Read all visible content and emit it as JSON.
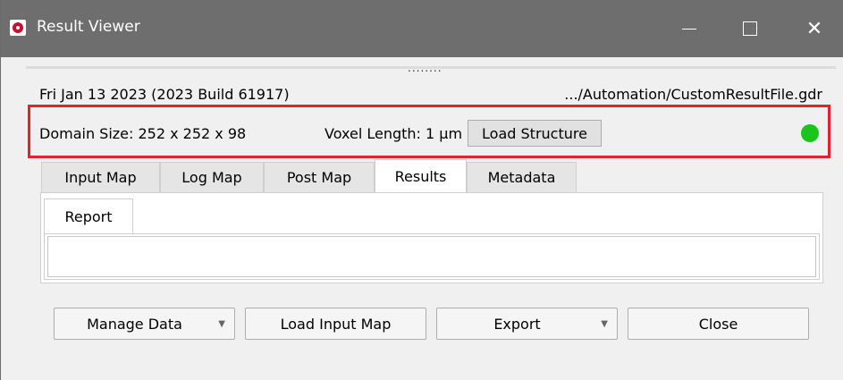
{
  "window": {
    "title": "Result Viewer",
    "controls": {
      "minimize": "minimize",
      "maximize": "maximize",
      "close": "close"
    }
  },
  "splitter": {
    "grip": "........"
  },
  "info": {
    "date_build": "Fri Jan 13 2023 (2023 Build 61917)",
    "file_path": ".../Automation/CustomResultFile.gdr"
  },
  "structure": {
    "domain_size": "Domain Size: 252 x 252 x 98",
    "voxel_length": "Voxel Length: 1 μm",
    "load_structure_label": "Load Structure",
    "status_color": "#19c41c"
  },
  "tabs": [
    {
      "label": "Input Map",
      "active": false
    },
    {
      "label": "Log Map",
      "active": false
    },
    {
      "label": "Post Map",
      "active": false
    },
    {
      "label": "Results",
      "active": true
    },
    {
      "label": "Metadata",
      "active": false
    }
  ],
  "subtabs": [
    {
      "label": "Report",
      "active": true
    }
  ],
  "buttons": {
    "manage_data": "Manage Data",
    "load_input_map": "Load Input Map",
    "export": "Export",
    "close": "Close"
  },
  "colors": {
    "titlebar": "#6e6e6e",
    "highlight": "#e8202c",
    "status": "#19c41c"
  }
}
